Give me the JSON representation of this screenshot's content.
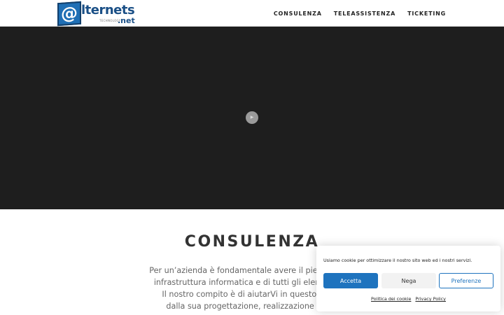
{
  "logo": {
    "at_symbol": "@",
    "wordmark": "lternets",
    "tagline": "TECHNOLOGY",
    "domain_suffix": ".net"
  },
  "nav": {
    "items": [
      {
        "label": "CONSULENZA"
      },
      {
        "label": "TELEASSISTENZA"
      },
      {
        "label": "TICKETING"
      }
    ]
  },
  "hero": {
    "play_icon": "play-icon",
    "play_glyph": "▶"
  },
  "content": {
    "heading": "CONSULENZA",
    "lines": [
      "Per un’azienda è fondamentale avere il pieno contro",
      "infrastruttura informatica e di tutti gli elementi ad",
      "Il nostro compito è di aiutarVi in questo scopo",
      "dalla sua progettazione, realizzazione e ges"
    ]
  },
  "cookie_banner": {
    "message": "Usiamo cookie per ottimizzare il nostro sito web ed i nostri servizi.",
    "accept_label": "Accetta",
    "deny_label": "Nega",
    "preferences_label": "Preferenze",
    "cookie_policy_link": "Politica dei cookie",
    "privacy_policy_link": "Privacy Policy"
  },
  "colors": {
    "brand_blue": "#1e73be",
    "hero_bg": "#1e1e1e",
    "heading_text": "#333333"
  }
}
